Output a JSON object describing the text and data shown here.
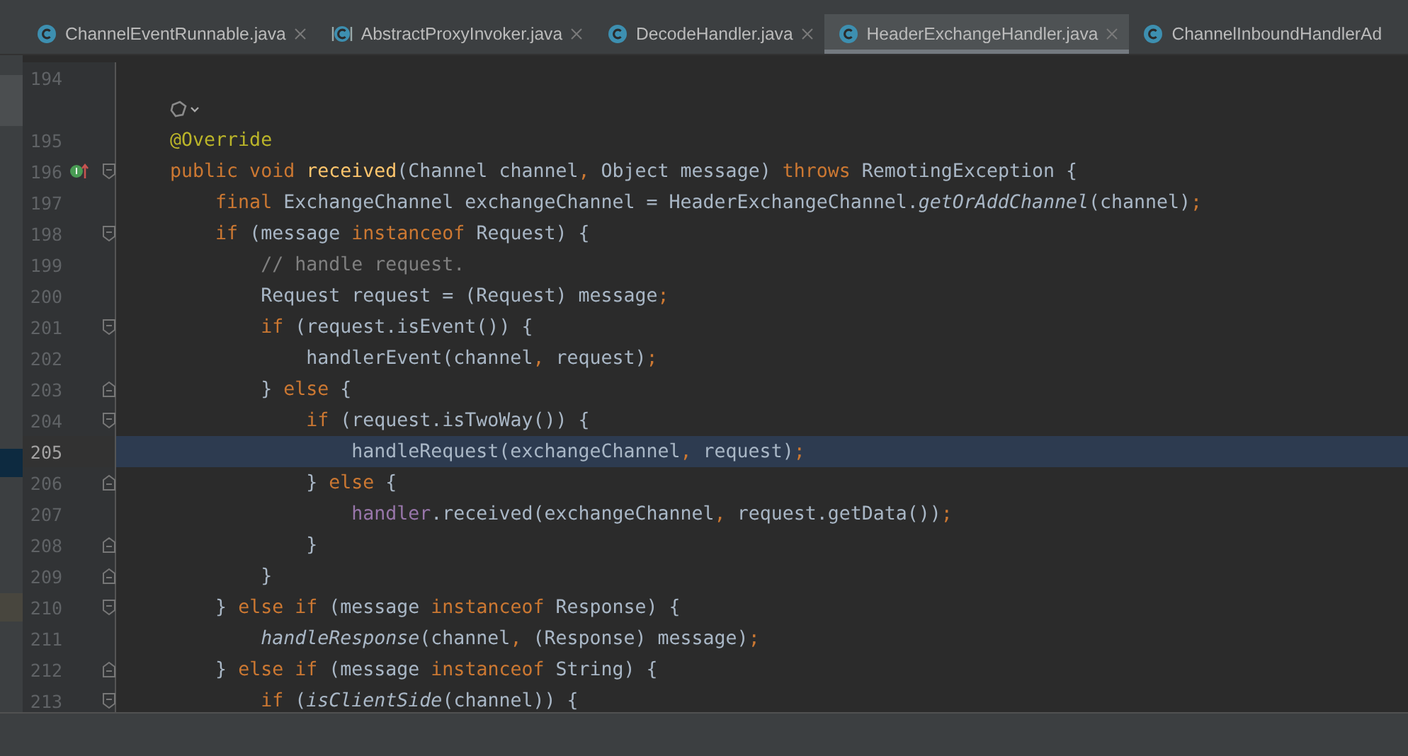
{
  "tabs": [
    {
      "label": "ChannelEventRunnable.java",
      "kind": "class",
      "selected": false,
      "closable": true
    },
    {
      "label": "AbstractProxyInvoker.java",
      "kind": "abstract",
      "selected": false,
      "closable": true
    },
    {
      "label": "DecodeHandler.java",
      "kind": "class",
      "selected": false,
      "closable": true
    },
    {
      "label": "HeaderExchangeHandler.java",
      "kind": "class",
      "selected": true,
      "closable": true
    },
    {
      "label": "ChannelInboundHandlerAd",
      "kind": "class",
      "selected": false,
      "closable": false
    }
  ],
  "lines": [
    {
      "kind": "code",
      "number": "194",
      "current": false
    },
    {
      "kind": "hint"
    },
    {
      "kind": "code",
      "number": "195",
      "current": false,
      "tokens": [
        {
          "text": "    @Override",
          "kind": "annotation"
        }
      ]
    },
    {
      "kind": "code",
      "number": "196",
      "current": false,
      "fold_start": true,
      "implemented": true,
      "tokens": [
        {
          "text": "    public void ",
          "kind": "keyword"
        },
        {
          "text": "received",
          "kind": "method"
        },
        {
          "text": "(Channel channel",
          "kind": "plain"
        },
        {
          "text": ", ",
          "kind": "keyword"
        },
        {
          "text": "Object message) ",
          "kind": "plain"
        },
        {
          "text": "throws ",
          "kind": "keyword"
        },
        {
          "text": "RemotingException {",
          "kind": "plain"
        }
      ]
    },
    {
      "kind": "code",
      "number": "197",
      "current": false,
      "tokens": [
        {
          "text": "        final ",
          "kind": "keyword"
        },
        {
          "text": "ExchangeChannel exchangeChannel = HeaderExchangeChannel.",
          "kind": "plain"
        },
        {
          "text": "getOrAddChannel",
          "kind": "static"
        },
        {
          "text": "(channel)",
          "kind": "plain"
        },
        {
          "text": ";",
          "kind": "keyword"
        }
      ]
    },
    {
      "kind": "code",
      "number": "198",
      "current": false,
      "fold_start": true,
      "tokens": [
        {
          "text": "        if ",
          "kind": "keyword"
        },
        {
          "text": "(message ",
          "kind": "plain"
        },
        {
          "text": "instanceof ",
          "kind": "keyword"
        },
        {
          "text": "Request) {",
          "kind": "plain"
        }
      ]
    },
    {
      "kind": "code",
      "number": "199",
      "current": false,
      "tokens": [
        {
          "text": "            // handle request.",
          "kind": "comment"
        }
      ]
    },
    {
      "kind": "code",
      "number": "200",
      "current": false,
      "tokens": [
        {
          "text": "            Request request = (Request) message",
          "kind": "plain"
        },
        {
          "text": ";",
          "kind": "keyword"
        }
      ]
    },
    {
      "kind": "code",
      "number": "201",
      "current": false,
      "fold_start": true,
      "tokens": [
        {
          "text": "            if ",
          "kind": "keyword"
        },
        {
          "text": "(request.isEvent()) {",
          "kind": "plain"
        }
      ]
    },
    {
      "kind": "code",
      "number": "202",
      "current": false,
      "tokens": [
        {
          "text": "                handlerEvent(channel",
          "kind": "plain"
        },
        {
          "text": ", ",
          "kind": "keyword"
        },
        {
          "text": "request)",
          "kind": "plain"
        },
        {
          "text": ";",
          "kind": "keyword"
        }
      ]
    },
    {
      "kind": "code",
      "number": "203",
      "current": false,
      "fold_end": true,
      "tokens": [
        {
          "text": "            } ",
          "kind": "plain"
        },
        {
          "text": "else ",
          "kind": "keyword"
        },
        {
          "text": "{",
          "kind": "plain"
        }
      ]
    },
    {
      "kind": "code",
      "number": "204",
      "current": false,
      "fold_start": true,
      "tokens": [
        {
          "text": "                if ",
          "kind": "keyword"
        },
        {
          "text": "(request.isTwoWay()) {",
          "kind": "plain"
        }
      ]
    },
    {
      "kind": "code",
      "number": "205",
      "current": true,
      "tokens": [
        {
          "text": "                    handleRequest(exchangeChannel",
          "kind": "plain"
        },
        {
          "text": ", ",
          "kind": "keyword"
        },
        {
          "text": "request)",
          "kind": "plain"
        },
        {
          "text": ";",
          "kind": "keyword"
        }
      ]
    },
    {
      "kind": "code",
      "number": "206",
      "current": false,
      "fold_end": true,
      "tokens": [
        {
          "text": "                } ",
          "kind": "plain"
        },
        {
          "text": "else ",
          "kind": "keyword"
        },
        {
          "text": "{",
          "kind": "plain"
        }
      ]
    },
    {
      "kind": "code",
      "number": "207",
      "current": false,
      "tokens": [
        {
          "text": "                    handler",
          "kind": "field"
        },
        {
          "text": ".received(exchangeChannel",
          "kind": "plain"
        },
        {
          "text": ", ",
          "kind": "keyword"
        },
        {
          "text": "request.getData())",
          "kind": "plain"
        },
        {
          "text": ";",
          "kind": "keyword"
        }
      ]
    },
    {
      "kind": "code",
      "number": "208",
      "current": false,
      "fold_end": true,
      "tokens": [
        {
          "text": "                }",
          "kind": "plain"
        }
      ]
    },
    {
      "kind": "code",
      "number": "209",
      "current": false,
      "fold_end": true,
      "tokens": [
        {
          "text": "            }",
          "kind": "plain"
        }
      ]
    },
    {
      "kind": "code",
      "number": "210",
      "current": false,
      "fold_start": true,
      "tokens": [
        {
          "text": "        } ",
          "kind": "plain"
        },
        {
          "text": "else if ",
          "kind": "keyword"
        },
        {
          "text": "(message ",
          "kind": "plain"
        },
        {
          "text": "instanceof ",
          "kind": "keyword"
        },
        {
          "text": "Response) {",
          "kind": "plain"
        }
      ]
    },
    {
      "kind": "code",
      "number": "211",
      "current": false,
      "tokens": [
        {
          "text": "            handleResponse",
          "kind": "static"
        },
        {
          "text": "(channel",
          "kind": "plain"
        },
        {
          "text": ", ",
          "kind": "keyword"
        },
        {
          "text": "(Response) message)",
          "kind": "plain"
        },
        {
          "text": ";",
          "kind": "keyword"
        }
      ]
    },
    {
      "kind": "code",
      "number": "212",
      "current": false,
      "fold_end": true,
      "tokens": [
        {
          "text": "        } ",
          "kind": "plain"
        },
        {
          "text": "else if ",
          "kind": "keyword"
        },
        {
          "text": "(message ",
          "kind": "plain"
        },
        {
          "text": "instanceof ",
          "kind": "keyword"
        },
        {
          "text": "String) {",
          "kind": "plain"
        }
      ]
    },
    {
      "kind": "code",
      "number": "213",
      "current": false,
      "fold_start": true,
      "tokens": [
        {
          "text": "            if ",
          "kind": "keyword"
        },
        {
          "text": "(",
          "kind": "plain"
        },
        {
          "text": "isClientSide",
          "kind": "static"
        },
        {
          "text": "(channel)) {",
          "kind": "plain"
        }
      ]
    }
  ]
}
